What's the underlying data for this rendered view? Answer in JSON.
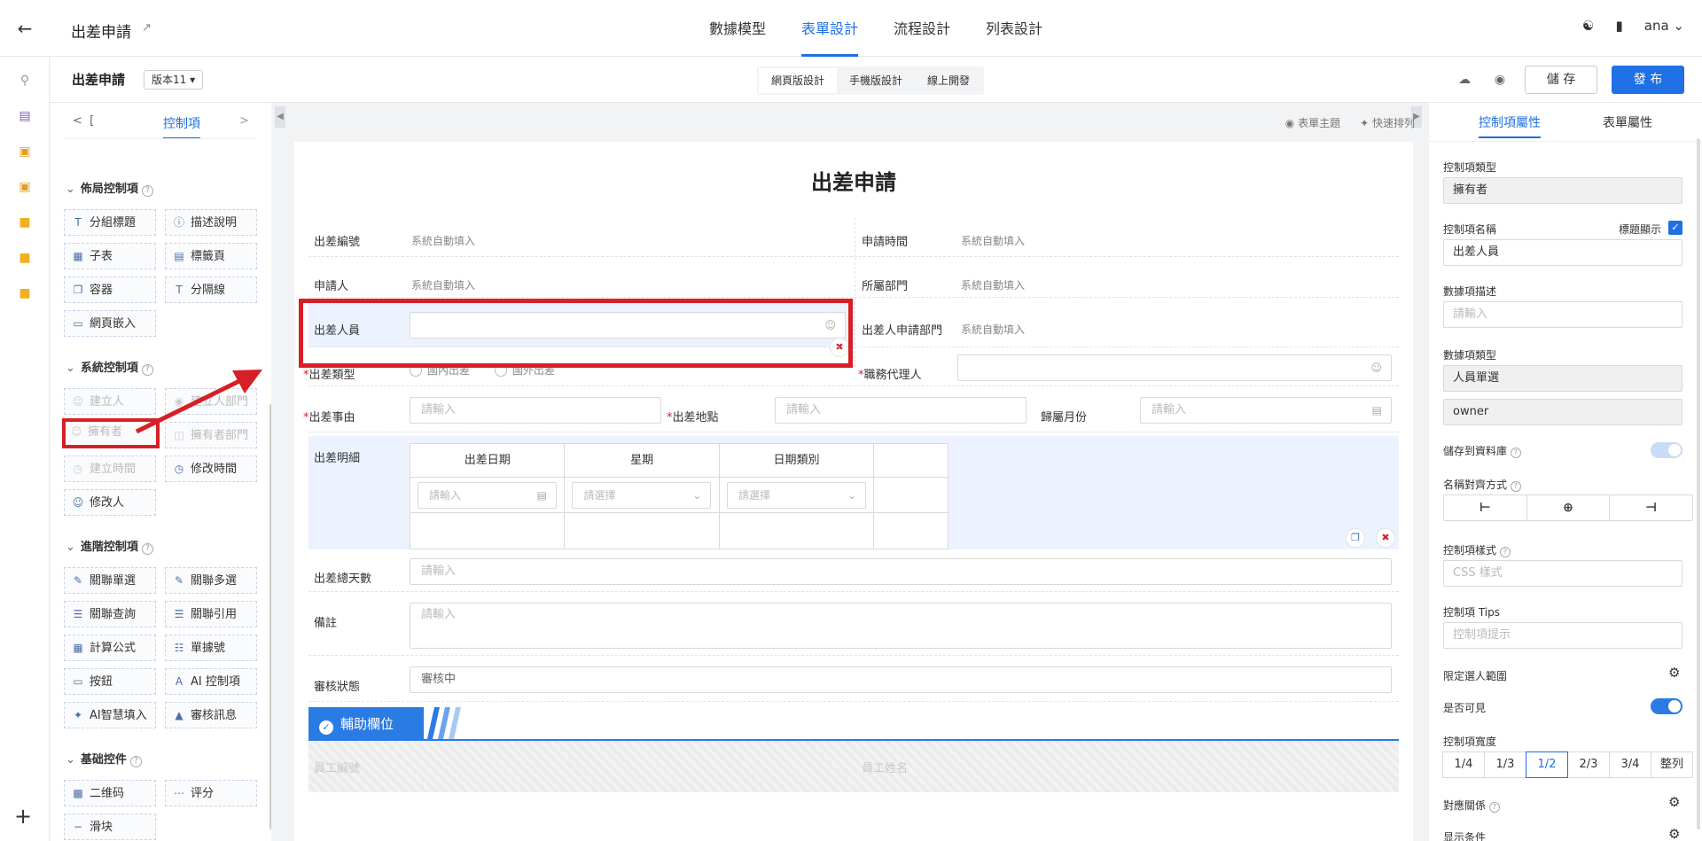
{
  "header": {
    "title": "出差申請",
    "tabs": [
      "數據模型",
      "表單設計",
      "流程設計",
      "列表設計"
    ],
    "active_tab": "表單設計",
    "user": "ana"
  },
  "toolbar": {
    "form_name": "出差申請",
    "version": "版本11",
    "modes": [
      "網頁版設計",
      "手機版設計",
      "線上開發"
    ],
    "save_label": "儲 存",
    "publish_label": "發 布"
  },
  "controls": {
    "tab_prev": "[",
    "tab_active": "控制項",
    "layout_title": "佈局控制項",
    "layout_items": [
      "分組標題",
      "描述說明",
      "子表",
      "標籤頁",
      "容器",
      "分隔線",
      "網頁嵌入"
    ],
    "system_title": "系統控制項",
    "system_items": [
      "建立人",
      "建立人部門",
      "擁有者",
      "擁有者部門",
      "建立時間",
      "修改時間",
      "修改人"
    ],
    "advanced_title": "進階控制項",
    "advanced_items": [
      "關聯單選",
      "關聯多選",
      "關聯查詢",
      "關聯引用",
      "計算公式",
      "單據號",
      "按鈕",
      "AI 控制項",
      "AI智慧填入",
      "審核訊息"
    ],
    "basic_title": "基础控件",
    "basic_items": [
      "二维码",
      "评分",
      "滑块"
    ]
  },
  "canvas": {
    "theme_label": "表單主題",
    "arrange_label": "快速排列",
    "form_title": "出差申請",
    "auto_fill": "系統自動填入",
    "fields": {
      "trip_no": "出差編號",
      "apply_time": "申請時間",
      "applicant": "申請人",
      "department": "所屬部門",
      "traveler": "出差人員",
      "traveler_dept": "出差人申請部門",
      "trip_type": "出差類型",
      "domestic": "國內出差",
      "overseas": "國外出差",
      "deputy": "職務代理人",
      "reason": "出差事由",
      "location": "出差地點",
      "month": "歸屬月份",
      "details": "出差明細",
      "total_days": "出差總天數",
      "remarks": "備註",
      "review_status": "審核狀態",
      "review_value": "審核中"
    },
    "placeholder_input": "請輸入",
    "placeholder_select": "請選擇",
    "subtable_headers": [
      "出差日期",
      "星期",
      "日期類別"
    ],
    "aux_title": "輔助欄位",
    "aux_field_1": "員工編號",
    "aux_field_2": "員工姓名"
  },
  "props": {
    "tab_control": "控制項屬性",
    "tab_form": "表單屬性",
    "type_label": "控制項類型",
    "type_value": "擁有者",
    "name_label": "控制項名稱",
    "title_display": "標題顯示",
    "name_value": "出差人員",
    "desc_label": "數據項描述",
    "desc_placeholder": "請輸入",
    "data_type_label": "數據項類型",
    "data_type_value": "人員單選",
    "field_code": "owner",
    "save_db_label": "儲存到資料庫",
    "align_label": "名稱對齊方式",
    "style_label": "控制項樣式",
    "style_placeholder": "CSS 樣式",
    "tips_label": "控制項 Tips",
    "tips_placeholder": "控制項提示",
    "limit_label": "限定選人範圍",
    "visible_label": "是否可見",
    "width_label": "控制項寬度",
    "widths": [
      "1/4",
      "1/3",
      "1/2",
      "2/3",
      "3/4",
      "整列"
    ],
    "active_width": "1/2",
    "mapping_label": "對應關係",
    "display_cond_label": "显示条件"
  }
}
